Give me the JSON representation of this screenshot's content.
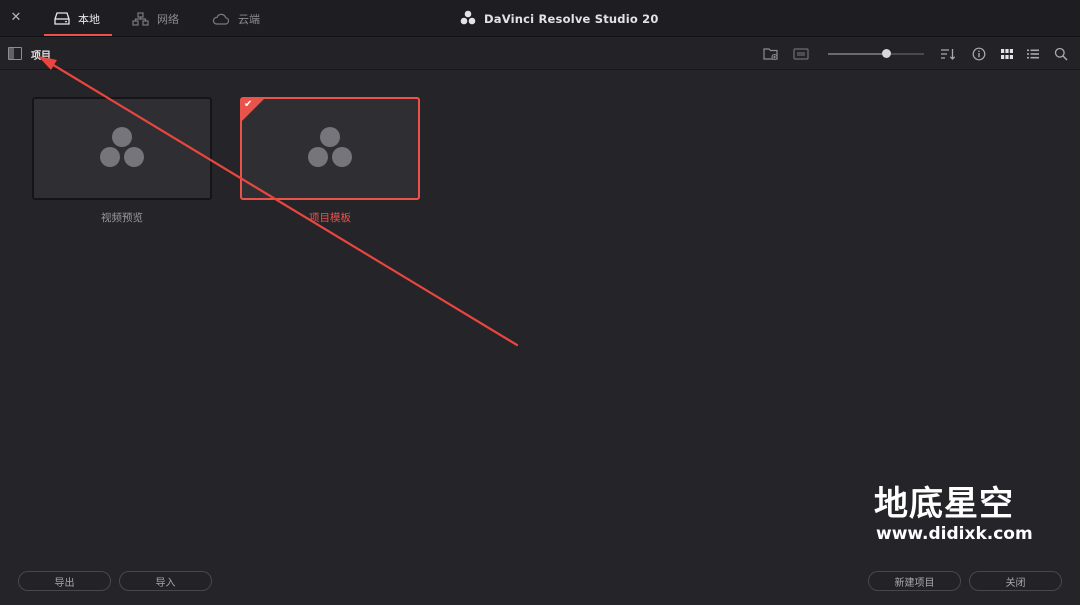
{
  "window": {
    "close_glyph": "✕",
    "app_title": "DaVinci Resolve Studio 20",
    "logo_icon": "davinci-logo-icon"
  },
  "tabs": [
    {
      "label": "本地",
      "icon": "local-drive-icon",
      "active": true
    },
    {
      "label": "网络",
      "icon": "network-icon",
      "active": false
    },
    {
      "label": "云端",
      "icon": "cloud-icon",
      "active": false
    }
  ],
  "toolbar": {
    "title": "项目",
    "zoom_level": 0.6,
    "icons": [
      "sidebar-toggle-icon",
      "new-folder-icon",
      "media-card-icon",
      "sort-icon",
      "info-icon",
      "grid-view-icon",
      "list-view-icon",
      "search-icon"
    ]
  },
  "projects": [
    {
      "label": "视频预览",
      "selected": false
    },
    {
      "label": "项目模板",
      "selected": true
    }
  ],
  "watermark": {
    "title": "地底星空",
    "url": "www.didixk.com"
  },
  "buttons": {
    "export": "导出",
    "import": "导入",
    "new_project": "新建项目",
    "close": "关闭"
  },
  "colors": {
    "accent": "#e9534a",
    "background": "#252429",
    "topbar": "#1e1d21"
  }
}
